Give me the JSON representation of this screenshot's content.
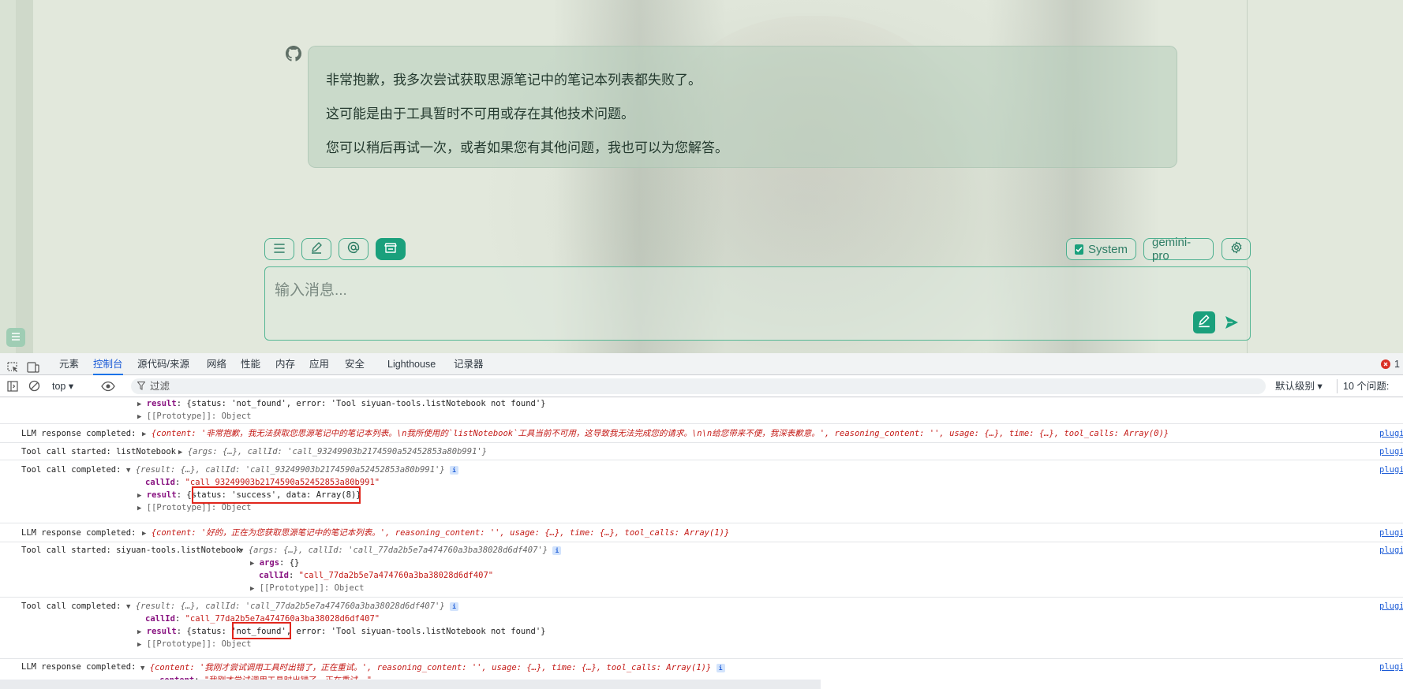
{
  "chat": {
    "message_lines": [
      "非常抱歉，我多次尝试获取思源笔记中的笔记本列表都失败了。",
      "这可能是由于工具暂时不可用或存在其他技术问题。",
      "您可以稍后再试一次，或者如果您有其他问题，我也可以为您解答。"
    ],
    "system_label": "System",
    "model_label": "gemini-pro",
    "input_placeholder": "输入消息..."
  },
  "devtools": {
    "tabs": [
      "元素",
      "控制台",
      "源代码/来源",
      "网络",
      "性能",
      "内存",
      "应用",
      "安全",
      "Lighthouse",
      "记录器"
    ],
    "selected_tab": "控制台",
    "error_count": "1",
    "context": "top",
    "filter_placeholder": "过滤",
    "level": "默认级别",
    "issues": "10 个问题:"
  },
  "console": {
    "r0_a": "result",
    "r0_b": "{status: 'not_found', error: 'Tool siyuan-tools.listNotebook not found'}",
    "r0_c": "[[Prototype]]: Object",
    "r1_label": "LLM response completed:",
    "r1_obj": "{content: '非常抱歉，我无法获取您思源笔记中的笔记本列表。\\n我所使用的`listNotebook`工具当前不可用，这导致我无法完成您的请求。\\n\\n给您带来不便，我深表歉意。', reasoning_content: '', usage: {…}, time: {…}, tool_calls: Array(0)}",
    "r2_label": "Tool call started: listNotebook",
    "r2_obj": "{args: {…}, callId: 'call_93249903b2174590a52452853a80b991'}",
    "r3_label": "Tool call completed:",
    "r3_obj": "{result: {…}, callId: 'call_93249903b2174590a52452853a80b991'}",
    "r3_callid_key": "callId",
    "r3_callid_val": "\"call_93249903b2174590a52452853a80b991\"",
    "r3_result_key": "result",
    "r3_result_val": "{status: 'success', data: Array(8)}",
    "r3_proto": "[[Prototype]]: Object",
    "r4_label": "LLM response completed:",
    "r4_obj": "{content: '好的，正在为您获取思源笔记中的笔记本列表。', reasoning_content: '', usage: {…}, time: {…}, tool_calls: Array(1)}",
    "r5_label": "Tool call started: siyuan-tools.listNotebook",
    "r5_obj": "{args: {…}, callId: 'call_77da2b5e7a474760a3ba38028d6df407'}",
    "r5_args_key": "args",
    "r5_args_val": "{}",
    "r5_callid_key": "callId",
    "r5_callid_val": "\"call_77da2b5e7a474760a3ba38028d6df407\"",
    "r5_proto": "[[Prototype]]: Object",
    "r6_label": "Tool call completed:",
    "r6_obj": "{result: {…}, callId: 'call_77da2b5e7a474760a3ba38028d6df407'}",
    "r6_callid_key": "callId",
    "r6_callid_val": "\"call_77da2b5e7a474760a3ba38028d6df407\"",
    "r6_result_key": "result",
    "r6_result_val": "{status: 'not_found', error: 'Tool siyuan-tools.listNotebook not found'}",
    "r6_proto": "[[Prototype]]: Object",
    "r7_label": "LLM response completed:",
    "r7_obj": "{content: '我刚才尝试调用工具时出错了，正在重试。', reasoning_content: '', usage: {…}, time: {…}, tool_calls: Array(1)}",
    "r7_content_key": "content",
    "r7_content_val": "\"我刚才尝试调用工具时出错了，正在重试。\"",
    "r7_reason_key": "reasoning_content",
    "r7_reason_val": "\"\"",
    "source_link": "plugin"
  }
}
